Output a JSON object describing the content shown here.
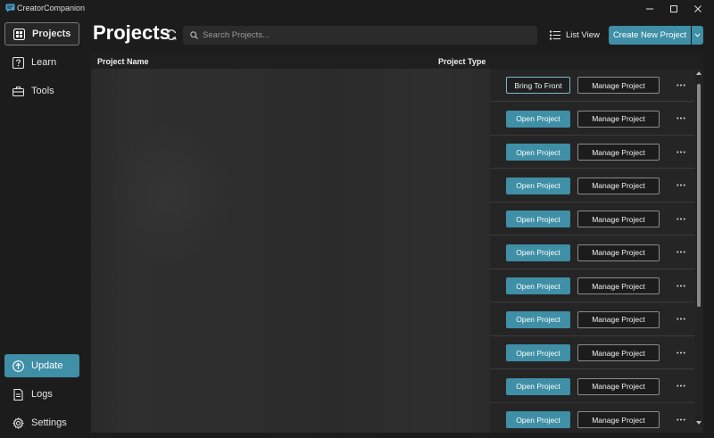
{
  "window": {
    "title": "CreatorCompanion"
  },
  "sidebar": {
    "items": [
      {
        "label": "Projects",
        "icon": "grid-icon"
      },
      {
        "label": "Learn",
        "icon": "question-icon"
      },
      {
        "label": "Tools",
        "icon": "toolbox-icon"
      },
      {
        "label": "Update",
        "icon": "arrow-up-circle-icon"
      },
      {
        "label": "Logs",
        "icon": "document-icon"
      },
      {
        "label": "Settings",
        "icon": "gear-icon"
      }
    ]
  },
  "header": {
    "title": "Projects",
    "search_placeholder": "Search Projects...",
    "list_view_label": "List View",
    "create_label": "Create New Project"
  },
  "table": {
    "columns": [
      "Project Name",
      "Project Type"
    ],
    "rows": [
      {
        "primary_action": "Bring To Front",
        "secondary_action": "Manage Project"
      },
      {
        "primary_action": "Open Project",
        "secondary_action": "Manage Project"
      },
      {
        "primary_action": "Open Project",
        "secondary_action": "Manage Project"
      },
      {
        "primary_action": "Open Project",
        "secondary_action": "Manage Project"
      },
      {
        "primary_action": "Open Project",
        "secondary_action": "Manage Project"
      },
      {
        "primary_action": "Open Project",
        "secondary_action": "Manage Project"
      },
      {
        "primary_action": "Open Project",
        "secondary_action": "Manage Project"
      },
      {
        "primary_action": "Open Project",
        "secondary_action": "Manage Project"
      },
      {
        "primary_action": "Open Project",
        "secondary_action": "Manage Project"
      },
      {
        "primary_action": "Open Project",
        "secondary_action": "Manage Project"
      },
      {
        "primary_action": "Open Project",
        "secondary_action": "Manage Project"
      }
    ]
  },
  "colors": {
    "accent": "#3f8fa6",
    "background": "#1c1c1c",
    "panel": "#262626"
  }
}
